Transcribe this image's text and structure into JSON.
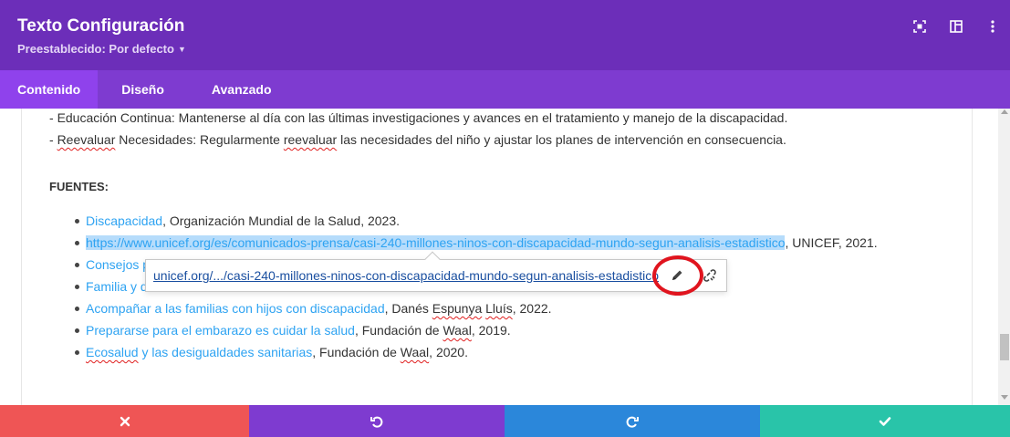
{
  "header": {
    "title": "Texto Configuración",
    "preset": "Preestablecido: Por defecto",
    "icons": [
      "fullscreen-icon",
      "split-view-icon",
      "more-vertical-icon"
    ],
    "bg_color": "#6c2eb9"
  },
  "tabs": [
    {
      "label": "Contenido",
      "active": true
    },
    {
      "label": "Diseño",
      "active": false
    },
    {
      "label": "Avanzado",
      "active": false
    }
  ],
  "content": {
    "lines": [
      {
        "prefix": "- ",
        "text": "Educación Continua: Mantenerse al día con las últimas investigaciones y avances en el tratamiento y manejo de la discapacidad."
      },
      {
        "prefix": "- ",
        "word1": "Reevaluar",
        "mid": " Necesidades: Regularmente ",
        "word2": "reevaluar",
        "rest": " las necesidades del niño y ajustar los planes de intervención en consecuencia."
      }
    ],
    "sources_heading": "FUENTES:",
    "sources": [
      {
        "link": "Discapacidad",
        "rest": ", Organización Mundial de la Salud, 2023."
      },
      {
        "link": "https://www.unicef.org/es/comunicados-prensa/casi-240-millones-ninos-con-discapacidad-mundo-segun-analisis-estadistico",
        "rest": ", UNICEF, 2021."
      },
      {
        "link": "Consejos p",
        "rest": ""
      },
      {
        "link": "Familia y d",
        "rest": ""
      },
      {
        "link": "Acompañar a las familias con hijos con discapacidad",
        "rest_a": ", Danés ",
        "sq1": "Espunya",
        "mid": " ",
        "sq2": "Lluís",
        "rest_b": ", 2022."
      },
      {
        "link": "Prepararse para el embarazo es cuidar la salud",
        "rest_a": ", Fundación de ",
        "sq1": "Waal",
        "rest_b": ", 2019."
      },
      {
        "link_sq": "Ecosalud",
        "link": " y las desigualdades sanitarias",
        "rest_a": ", Fundación de ",
        "sq1": "Waal",
        "rest_b": ", 2020."
      }
    ]
  },
  "link_popup": {
    "url": "unicef.org/.../casi-240-millones-ninos-con-discapacidad-mundo-segun-analisis-estadistico",
    "edit_icon": "pencil-icon",
    "unlink_icon": "unlink-icon"
  },
  "footer": {
    "buttons": [
      {
        "name": "cancel",
        "icon": "close-icon",
        "color": "#ef5555"
      },
      {
        "name": "undo",
        "icon": "undo-icon",
        "color": "#7e3bd0"
      },
      {
        "name": "redo",
        "icon": "redo-icon",
        "color": "#2b87da"
      },
      {
        "name": "save",
        "icon": "check-icon",
        "color": "#29c4a9"
      }
    ]
  }
}
